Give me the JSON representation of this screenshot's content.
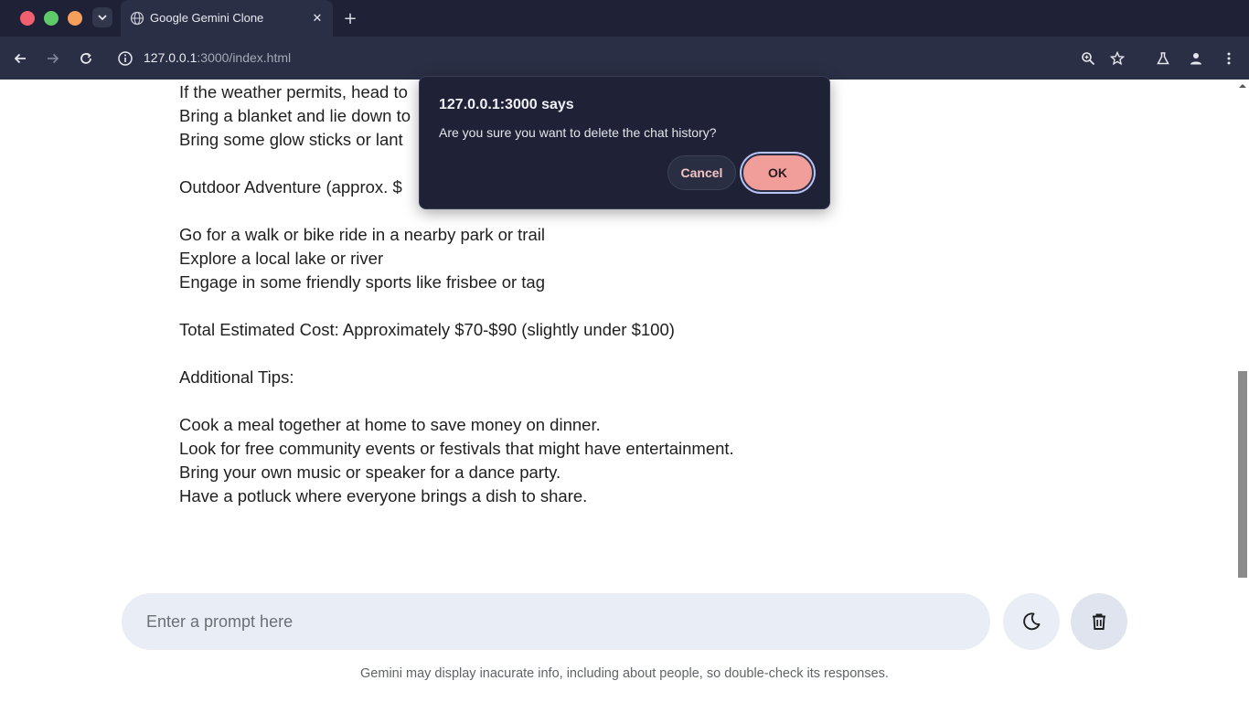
{
  "browser": {
    "tab_title": "Google Gemini Clone",
    "tab_close": "✕",
    "new_tab": "+",
    "url_host": "127.0.0.1",
    "url_rest": ":3000/index.html",
    "colors": {
      "titlebar": "#1f2237",
      "toolbar": "#2b2f45"
    }
  },
  "chat": {
    "lines": [
      "If the weather permits, head to",
      "Bring a blanket and lie down to",
      "Bring some glow sticks or lant",
      "",
      "Outdoor Adventure (approx. $",
      "",
      "Go for a walk or bike ride in a nearby park or trail",
      "Explore a local lake or river",
      "Engage in some friendly sports like frisbee or tag",
      "",
      "Total Estimated Cost: Approximately $70-$90 (slightly under $100)",
      "",
      "Additional Tips:",
      "",
      "Cook a meal together at home to save money on dinner.",
      "Look for free community events or festivals that might have entertainment.",
      "Bring your own music or speaker for a dance party.",
      "Have a potluck where everyone brings a dish to share."
    ]
  },
  "input": {
    "placeholder": "Enter a prompt here",
    "value": ""
  },
  "icons": {
    "theme": "moon-icon",
    "delete": "trash-icon"
  },
  "disclaimer": "Gemini may display inacurate info, including about people, so double-check its responses.",
  "dialog": {
    "title": "127.0.0.1:3000 says",
    "message": "Are you sure you want to delete the chat history?",
    "cancel_label": "Cancel",
    "ok_label": "OK",
    "colors": {
      "ok_bg": "#f19e9b",
      "bg": "#1f2237"
    }
  }
}
